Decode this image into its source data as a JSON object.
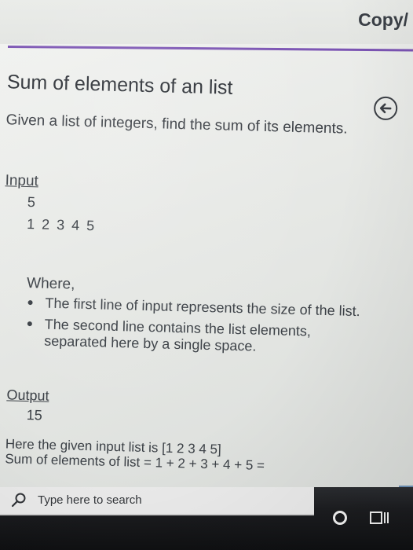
{
  "header": {
    "copy_link": "Copy/"
  },
  "problem": {
    "title": "Sum of elements of an list",
    "description": "Given a list of integers, find the sum of its elements.",
    "input_label": "Input",
    "input_lines": [
      "5",
      "1 2 3 4 5"
    ],
    "where_label": "Where,",
    "bullets": [
      "The first line of input represents the size of the list.",
      "The second line contains the list elements, separated here by a single space."
    ],
    "output_label": "Output",
    "output_value": "15",
    "explanation_lines": [
      "Here the given input list is [1 2 3 4 5]",
      "Sum of elements of list = 1 + 2 + 3 + 4 + 5 ="
    ]
  },
  "taskbar": {
    "search_placeholder": "Type here to search"
  },
  "icons": {
    "back": "back-arrow-icon",
    "search": "search-icon",
    "cortana": "cortana-icon",
    "task_view": "task-view-icon"
  },
  "colors": {
    "accent_line": "#7b54b3",
    "taskbar": "#1c1d20"
  }
}
